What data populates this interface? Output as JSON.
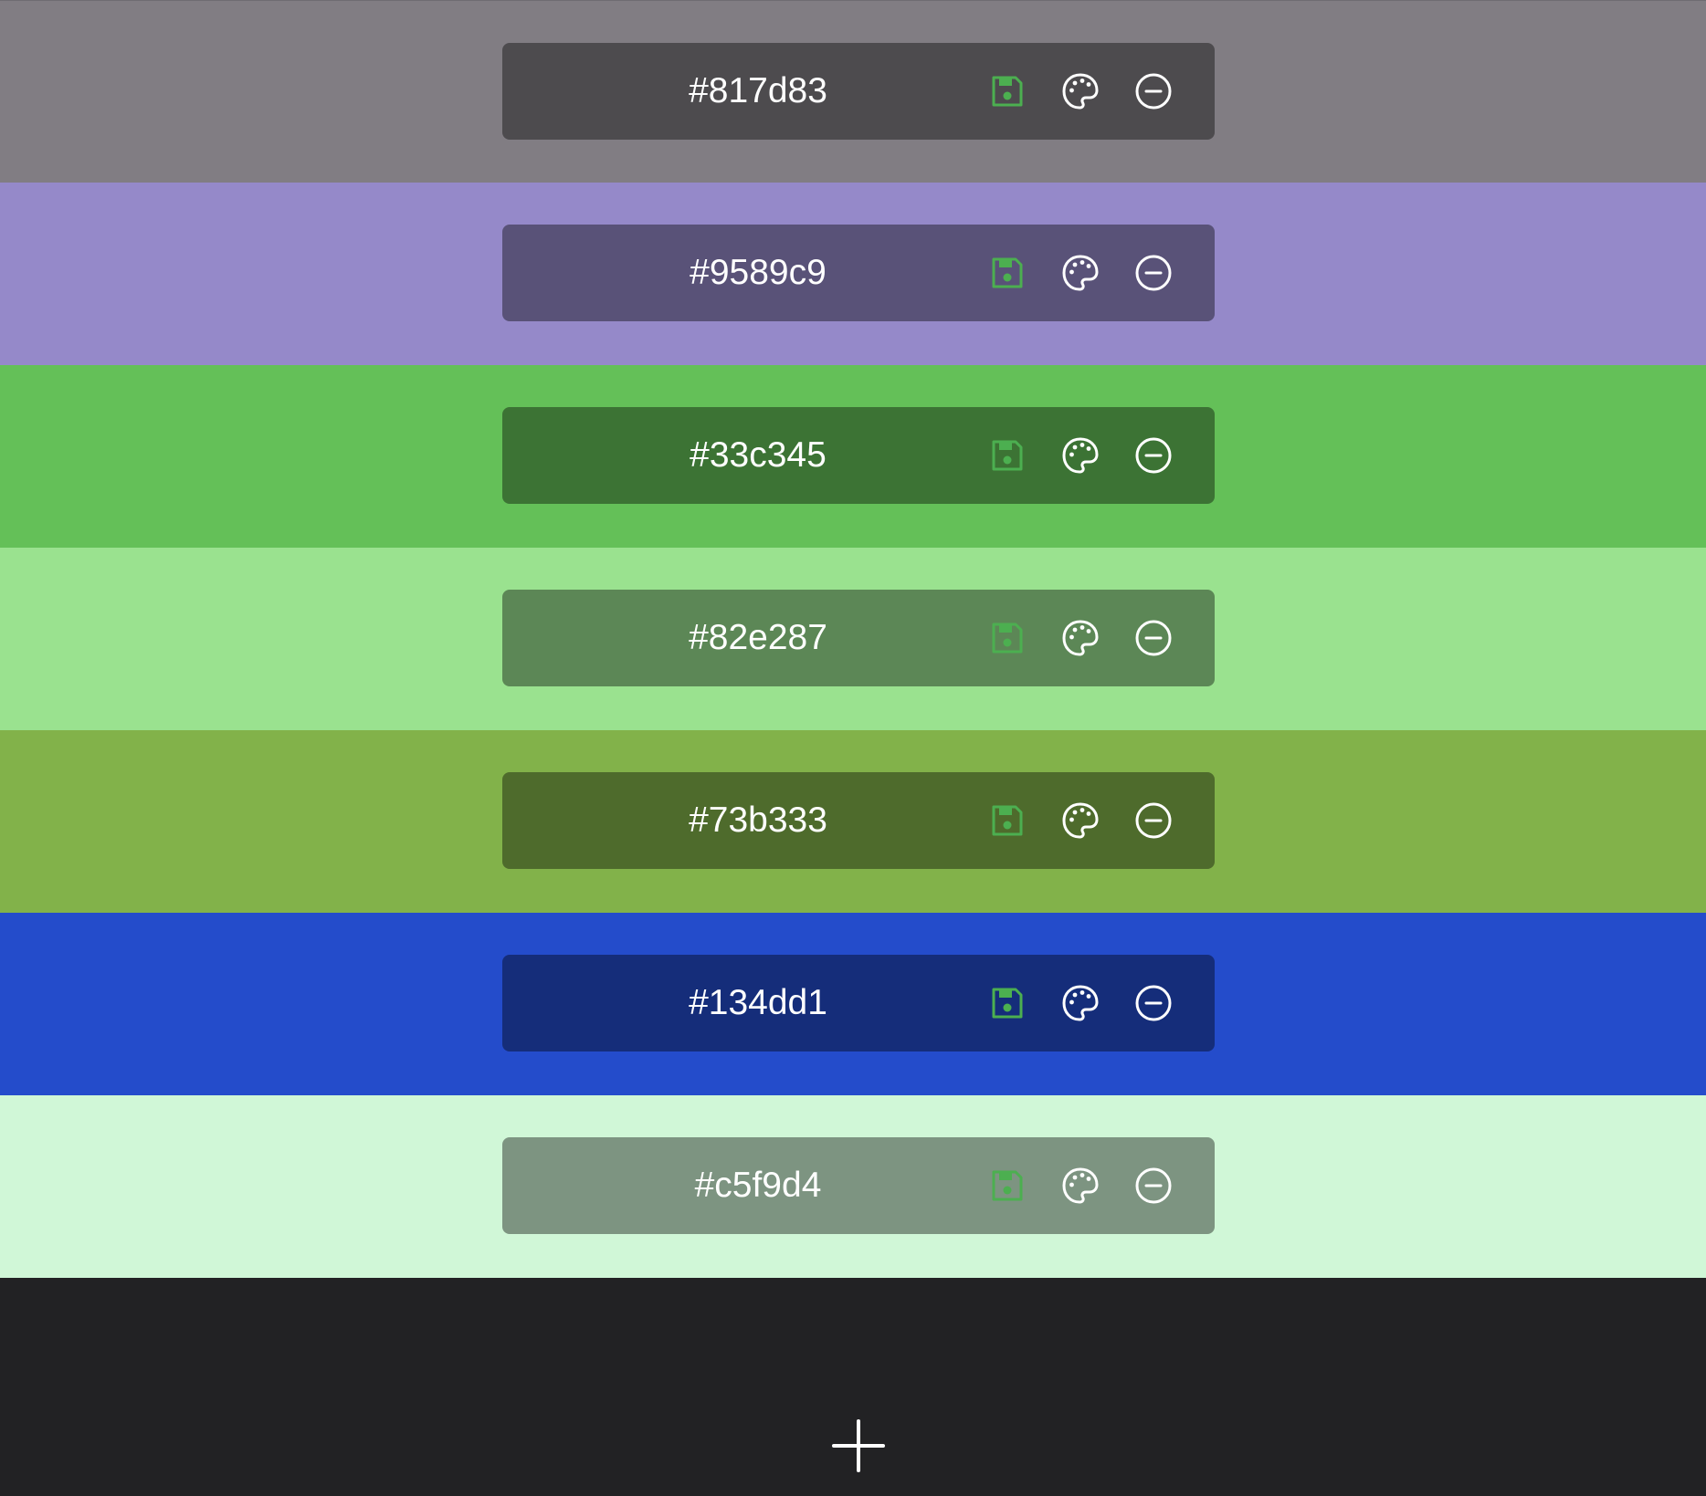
{
  "swatches": [
    {
      "hex": "#817d83",
      "bg": "#817d83"
    },
    {
      "hex": "#9589c9",
      "bg": "#9589c9"
    },
    {
      "hex": "#33c345",
      "bg": "#64c058"
    },
    {
      "hex": "#82e287",
      "bg": "#9ae28f"
    },
    {
      "hex": "#73b333",
      "bg": "#82b24a"
    },
    {
      "hex": "#134dd1",
      "bg": "#244ccb"
    },
    {
      "hex": "#c5f9d4",
      "bg": "#d0f7d7"
    }
  ],
  "icons": {
    "save": "floppy-disk-icon",
    "palette": "palette-icon",
    "remove": "minus-circle-icon",
    "add": "plus-icon"
  },
  "colors": {
    "save_icon": "#4caf50",
    "icon": "#ffffff",
    "footer_bg": "#222224"
  }
}
